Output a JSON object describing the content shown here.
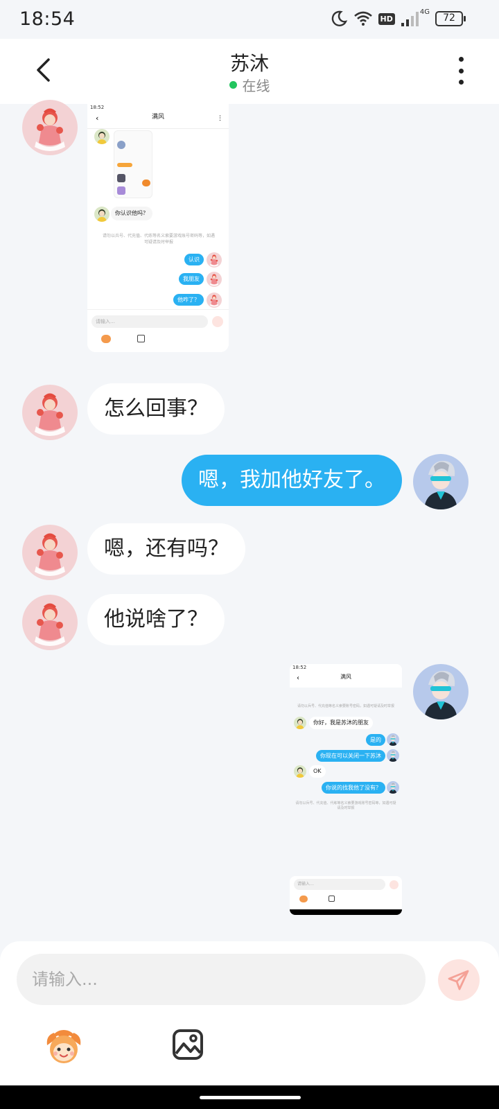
{
  "status_bar": {
    "time": "18:54",
    "hd": "HD",
    "network": "4G",
    "battery": "72"
  },
  "header": {
    "title": "苏沐",
    "status": "在线"
  },
  "messages": [
    {
      "type": "image",
      "sender": "contact"
    },
    {
      "type": "text",
      "sender": "contact",
      "text": "怎么回事？"
    },
    {
      "type": "text",
      "sender": "me",
      "text": "嗯，我加他好友了。"
    },
    {
      "type": "text",
      "sender": "contact",
      "text": "嗯，还有吗？"
    },
    {
      "type": "text",
      "sender": "contact",
      "text": "他说啥了？"
    },
    {
      "type": "image",
      "sender": "me"
    }
  ],
  "shot1": {
    "time": "18:52",
    "title": "满风",
    "q": "你认识他吗？",
    "notice": "请勿以兵号、代充值、代练等名义索要游戏账号密码等，如遇可疑请及时举报",
    "r1": "认识",
    "r2": "我朋友",
    "r3": "他咋了？",
    "placeholder": "请输入…"
  },
  "shot2": {
    "time": "18:52",
    "title": "满风",
    "notice": "请勿以兵号、代充值等名义索要账号密码，如遇可疑请及时举报",
    "m1": "你好，我是苏沐的朋友",
    "m2": "是的",
    "m3": "你现在可以关闭一下苏沐",
    "m4": "OK",
    "m5": "你说的找我他了没有？",
    "notice2": "请勿以兵号、代充值、代练等名义索要游戏账号密码等，如遇可疑请及时举报",
    "placeholder": "请输入…"
  },
  "input": {
    "placeholder": "请输入..."
  },
  "icons": {
    "back": "chevron-left-icon",
    "more": "more-vertical-icon",
    "send": "send-icon",
    "emoji": "emoji-monkey-icon",
    "image": "image-icon"
  },
  "colors": {
    "accent": "#2ab1f2",
    "online": "#22c55e",
    "send_bg": "#fde4e0",
    "send_icon": "#f4a196"
  }
}
